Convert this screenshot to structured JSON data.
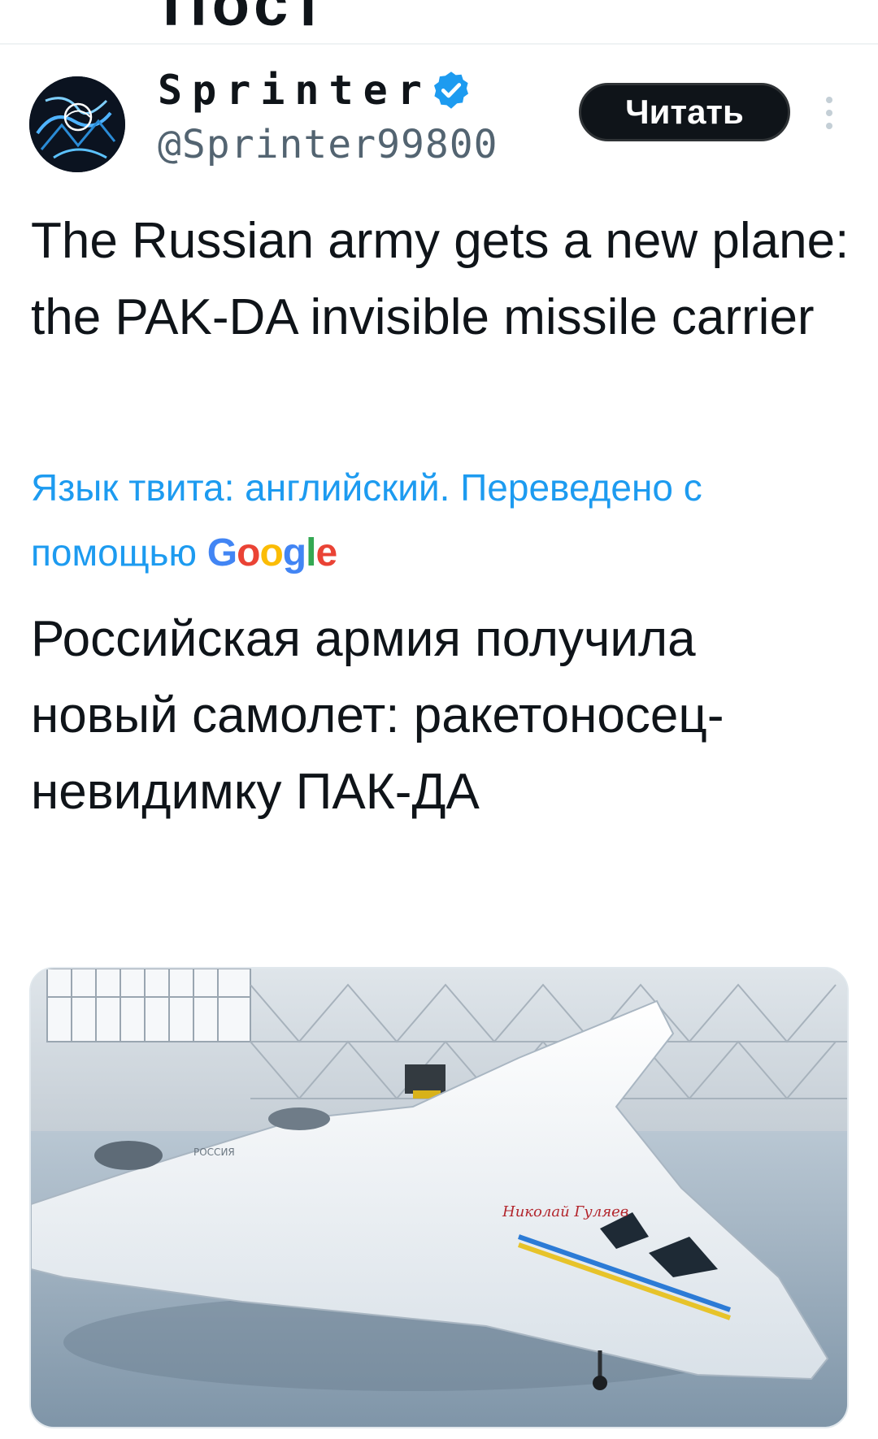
{
  "tweet": {
    "author": {
      "display_name": "Sprinter",
      "handle": "@Sprinter99800",
      "verified_icon": "verified-badge-icon"
    },
    "follow_label": "Читать",
    "more_icon": "more-vertical-icon",
    "text": "The Russian army gets a new plane: the PAK-DA invisible missile carrier",
    "translation_note": "Язык твита: английский. Переведено с помощью",
    "translation_provider": {
      "g1": "G",
      "o1": "o",
      "o2": "o",
      "g2": "g",
      "l": "l",
      "e": "e"
    },
    "translated_text": "Российская армия получила новый самолет: ракетоносец-невидимку ПАК-ДА",
    "media": {
      "plane_livery_text": "Николай Гуляев",
      "fuselage_text": "РОССИЯ"
    }
  },
  "colors": {
    "accent": "#1d9bf0",
    "text": "#0f1419",
    "secondary_text": "#536471",
    "button_bg": "#0f1419",
    "divider": "#eff3f4"
  }
}
